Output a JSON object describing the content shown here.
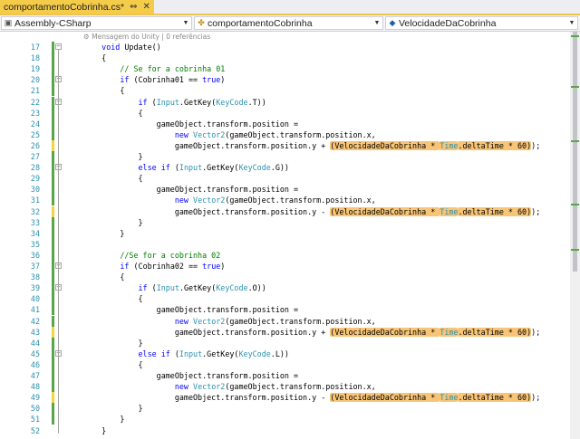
{
  "tab": {
    "title": "comportamentoCobrinha.cs*",
    "pin_icon": "⇔",
    "close_icon": "✕"
  },
  "nav": {
    "project": "Assembly-CSharp",
    "class": "comportamentoCobrinha",
    "member": "VelocidadeDaCobrinha"
  },
  "codelens": "⚙ Mensagem do Unity | 0 referências",
  "colors": {
    "tab_active": "#f5cc4a",
    "keyword": "#0000ff",
    "type": "#2b91af",
    "comment": "#008000",
    "highlight": "#f8c576",
    "change_saved": "#57a64a",
    "change_unsaved": "#f2d442"
  },
  "lines": [
    {
      "n": "17",
      "chg": "g",
      "fold": "−",
      "tokens": [
        [
          "    ",
          ""
        ],
        [
          "void",
          "k"
        ],
        [
          " Update()",
          ""
        ]
      ]
    },
    {
      "n": "18",
      "chg": "g",
      "fold": "",
      "tokens": [
        [
          "    {",
          ""
        ]
      ]
    },
    {
      "n": "19",
      "chg": "g",
      "fold": "",
      "tokens": [
        [
          "        ",
          ""
        ],
        [
          "// Se for a cobrinha 01",
          "c"
        ]
      ]
    },
    {
      "n": "20",
      "chg": "g",
      "fold": "−",
      "tokens": [
        [
          "        ",
          ""
        ],
        [
          "if",
          "k"
        ],
        [
          " (Cobrinha01 == ",
          ""
        ],
        [
          "true",
          "k"
        ],
        [
          ")",
          ""
        ]
      ]
    },
    {
      "n": "21",
      "chg": "g",
      "fold": "",
      "tokens": [
        [
          "        {",
          ""
        ]
      ]
    },
    {
      "n": "22",
      "chg": "g",
      "fold": "−",
      "tokens": [
        [
          "            ",
          ""
        ],
        [
          "if",
          "k"
        ],
        [
          " (",
          ""
        ],
        [
          "Input",
          "t"
        ],
        [
          ".GetKey(",
          ""
        ],
        [
          "KeyCode",
          "t"
        ],
        [
          ".T))",
          ""
        ]
      ]
    },
    {
      "n": "23",
      "chg": "g",
      "fold": "",
      "tokens": [
        [
          "            {",
          ""
        ]
      ]
    },
    {
      "n": "24",
      "chg": "g",
      "fold": "",
      "tokens": [
        [
          "                gameObject.transform.position =",
          ""
        ]
      ]
    },
    {
      "n": "25",
      "chg": "g",
      "fold": "",
      "tokens": [
        [
          "                    ",
          ""
        ],
        [
          "new",
          "k"
        ],
        [
          " ",
          ""
        ],
        [
          "Vector2",
          "t"
        ],
        [
          "(gameObject.transform.position.x,",
          ""
        ]
      ]
    },
    {
      "n": "26",
      "chg": "y",
      "fold": "",
      "tokens": [
        [
          "                    gameObject.transform.position.y + ",
          ""
        ],
        [
          "(VelocidadeDaCobrinha * ",
          "h"
        ],
        [
          "Time",
          "ht"
        ],
        [
          ".deltaTime * 60)",
          "h"
        ],
        [
          ");",
          ""
        ]
      ]
    },
    {
      "n": "27",
      "chg": "g",
      "fold": "",
      "tokens": [
        [
          "            }",
          ""
        ]
      ]
    },
    {
      "n": "28",
      "chg": "g",
      "fold": "−",
      "tokens": [
        [
          "            ",
          ""
        ],
        [
          "else",
          "k"
        ],
        [
          " ",
          ""
        ],
        [
          "if",
          "k"
        ],
        [
          " (",
          ""
        ],
        [
          "Input",
          "t"
        ],
        [
          ".GetKey(",
          ""
        ],
        [
          "KeyCode",
          "t"
        ],
        [
          ".G))",
          ""
        ]
      ]
    },
    {
      "n": "29",
      "chg": "g",
      "fold": "",
      "tokens": [
        [
          "            {",
          ""
        ]
      ]
    },
    {
      "n": "30",
      "chg": "g",
      "fold": "",
      "tokens": [
        [
          "                gameObject.transform.position =",
          ""
        ]
      ]
    },
    {
      "n": "31",
      "chg": "g",
      "fold": "",
      "tokens": [
        [
          "                    ",
          ""
        ],
        [
          "new",
          "k"
        ],
        [
          " ",
          ""
        ],
        [
          "Vector2",
          "t"
        ],
        [
          "(gameObject.transform.position.x,",
          ""
        ]
      ]
    },
    {
      "n": "32",
      "chg": "y",
      "fold": "",
      "tokens": [
        [
          "                    gameObject.transform.position.y - ",
          ""
        ],
        [
          "(VelocidadeDaCobrinha * ",
          "h"
        ],
        [
          "Time",
          "ht"
        ],
        [
          ".deltaTime * 60)",
          "h"
        ],
        [
          ");",
          ""
        ]
      ]
    },
    {
      "n": "33",
      "chg": "g",
      "fold": "",
      "tokens": [
        [
          "            }",
          ""
        ]
      ]
    },
    {
      "n": "34",
      "chg": "g",
      "fold": "",
      "tokens": [
        [
          "        }",
          ""
        ]
      ]
    },
    {
      "n": "35",
      "chg": "g",
      "fold": "",
      "tokens": [
        [
          "",
          ""
        ]
      ]
    },
    {
      "n": "36",
      "chg": "g",
      "fold": "",
      "tokens": [
        [
          "        ",
          ""
        ],
        [
          "//Se for a cobrinha 02",
          "c"
        ]
      ]
    },
    {
      "n": "37",
      "chg": "g",
      "fold": "−",
      "tokens": [
        [
          "        ",
          ""
        ],
        [
          "if",
          "k"
        ],
        [
          " (Cobrinha02 == ",
          ""
        ],
        [
          "true",
          "k"
        ],
        [
          ")",
          ""
        ]
      ]
    },
    {
      "n": "38",
      "chg": "g",
      "fold": "",
      "tokens": [
        [
          "        {",
          ""
        ]
      ]
    },
    {
      "n": "39",
      "chg": "g",
      "fold": "−",
      "tokens": [
        [
          "            ",
          ""
        ],
        [
          "if",
          "k"
        ],
        [
          " (",
          ""
        ],
        [
          "Input",
          "t"
        ],
        [
          ".GetKey(",
          ""
        ],
        [
          "KeyCode",
          "t"
        ],
        [
          ".O))",
          ""
        ]
      ]
    },
    {
      "n": "40",
      "chg": "g",
      "fold": "",
      "tokens": [
        [
          "            {",
          ""
        ]
      ]
    },
    {
      "n": "41",
      "chg": "g",
      "fold": "",
      "tokens": [
        [
          "                gameObject.transform.position =",
          ""
        ]
      ]
    },
    {
      "n": "42",
      "chg": "g",
      "fold": "",
      "tokens": [
        [
          "                    ",
          ""
        ],
        [
          "new",
          "k"
        ],
        [
          " ",
          ""
        ],
        [
          "Vector2",
          "t"
        ],
        [
          "(gameObject.transform.position.x,",
          ""
        ]
      ]
    },
    {
      "n": "43",
      "chg": "y",
      "fold": "",
      "tokens": [
        [
          "                    gameObject.transform.position.y + ",
          ""
        ],
        [
          "(VelocidadeDaCobrinha * ",
          "h"
        ],
        [
          "Time",
          "ht"
        ],
        [
          ".deltaTime * 60)",
          "h"
        ],
        [
          ");",
          ""
        ]
      ]
    },
    {
      "n": "44",
      "chg": "g",
      "fold": "",
      "tokens": [
        [
          "            }",
          ""
        ]
      ]
    },
    {
      "n": "45",
      "chg": "g",
      "fold": "−",
      "tokens": [
        [
          "            ",
          ""
        ],
        [
          "else",
          "k"
        ],
        [
          " ",
          ""
        ],
        [
          "if",
          "k"
        ],
        [
          " (",
          ""
        ],
        [
          "Input",
          "t"
        ],
        [
          ".GetKey(",
          ""
        ],
        [
          "KeyCode",
          "t"
        ],
        [
          ".L))",
          ""
        ]
      ]
    },
    {
      "n": "46",
      "chg": "g",
      "fold": "",
      "tokens": [
        [
          "            {",
          ""
        ]
      ]
    },
    {
      "n": "47",
      "chg": "g",
      "fold": "",
      "tokens": [
        [
          "                gameObject.transform.position =",
          ""
        ]
      ]
    },
    {
      "n": "48",
      "chg": "g",
      "fold": "",
      "tokens": [
        [
          "                    ",
          ""
        ],
        [
          "new",
          "k"
        ],
        [
          " ",
          ""
        ],
        [
          "Vector2",
          "t"
        ],
        [
          "(gameObject.transform.position.x,",
          ""
        ]
      ]
    },
    {
      "n": "49",
      "chg": "y",
      "fold": "",
      "tokens": [
        [
          "                    gameObject.transform.position.y - ",
          ""
        ],
        [
          "(VelocidadeDaCobrinha * ",
          "h"
        ],
        [
          "Time",
          "ht"
        ],
        [
          ".deltaTime * 60)",
          "h"
        ],
        [
          ");",
          ""
        ]
      ]
    },
    {
      "n": "50",
      "chg": "g",
      "fold": "",
      "tokens": [
        [
          "            }",
          ""
        ]
      ]
    },
    {
      "n": "51",
      "chg": "g",
      "fold": "",
      "tokens": [
        [
          "        }",
          ""
        ]
      ]
    },
    {
      "n": "52",
      "chg": "",
      "fold": "",
      "tokens": [
        [
          "    }",
          ""
        ]
      ]
    }
  ]
}
